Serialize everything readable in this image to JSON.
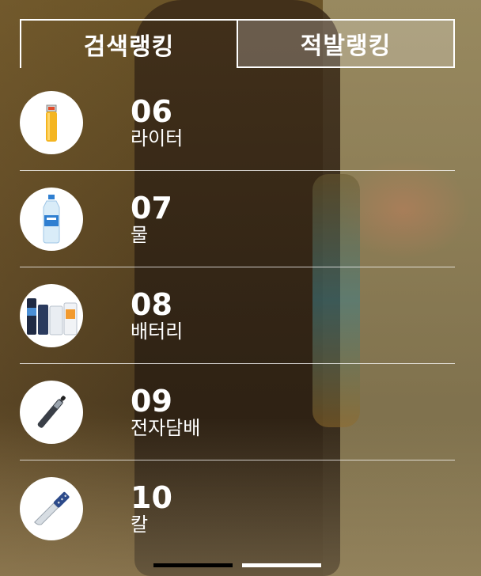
{
  "tabs": [
    {
      "label": "검색랭킹"
    },
    {
      "label": "적발랭킹"
    }
  ],
  "ranking": [
    {
      "rank": "06",
      "name": "라이터",
      "icon": "lighter-icon"
    },
    {
      "rank": "07",
      "name": "물",
      "icon": "water-bottle-icon"
    },
    {
      "rank": "08",
      "name": "배터리",
      "icon": "battery-icon"
    },
    {
      "rank": "09",
      "name": "전자담배",
      "icon": "e-cigarette-icon"
    },
    {
      "rank": "10",
      "name": "칼",
      "icon": "knife-icon"
    }
  ],
  "pagination": {
    "pages": 2,
    "current": 1
  }
}
